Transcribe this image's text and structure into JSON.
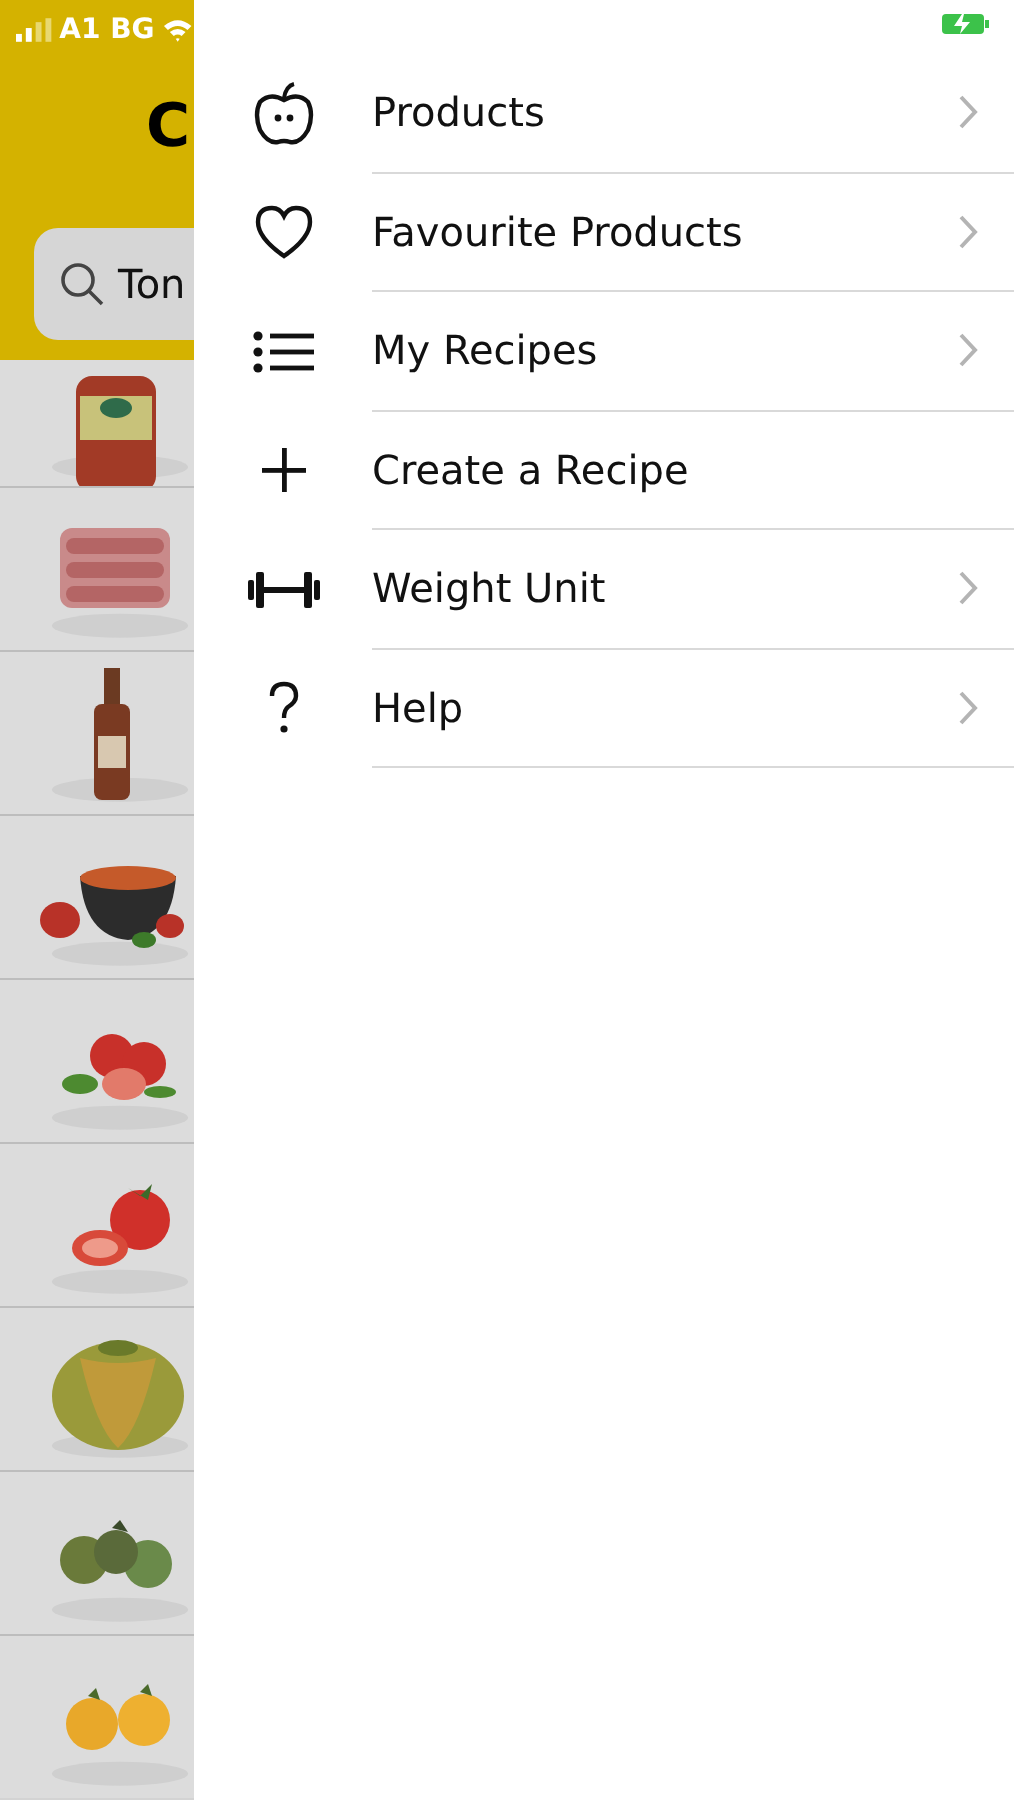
{
  "status_bar": {
    "carrier": "A1 BG",
    "battery_charging": true
  },
  "background": {
    "title": "C",
    "search": {
      "value": "Ton"
    }
  },
  "menu": {
    "items": [
      {
        "label": "Products",
        "chevron": true
      },
      {
        "label": "Favourite Products",
        "chevron": true
      },
      {
        "label": "My Recipes",
        "chevron": true
      },
      {
        "label": "Create a Recipe",
        "chevron": false
      },
      {
        "label": "Weight Unit",
        "chevron": true
      },
      {
        "label": "Help",
        "chevron": true
      }
    ]
  }
}
